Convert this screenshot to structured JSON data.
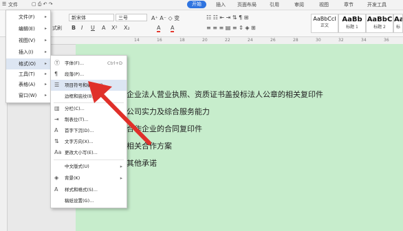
{
  "menubar": {
    "items": [
      "文件",
      "插入",
      "页面布局",
      "引用",
      "审阅",
      "视图",
      "章节",
      "开发工具"
    ],
    "active_tab": "开始"
  },
  "ribbon": {
    "font_name": "新宋体",
    "font_size": "三号",
    "paste_label": "式刷",
    "format_buttons": [
      "B",
      "I",
      "U",
      "A",
      "X²",
      "X₂",
      "A",
      "A"
    ],
    "styles": [
      {
        "preview": "AaBbCcI",
        "name": "正文"
      },
      {
        "preview": "AaBb",
        "name": "标题 1"
      },
      {
        "preview": "AaBbC",
        "name": "标题 2"
      },
      {
        "preview": "Aa",
        "name": "标"
      }
    ]
  },
  "ruler_ticks": [
    "14",
    "16",
    "18",
    "20",
    "22",
    "24",
    "26",
    "28",
    "30",
    "32",
    "34",
    "36"
  ],
  "main_menu": [
    {
      "label": "文件(F)",
      "arrow": "▸"
    },
    {
      "label": "编辑(E)",
      "arrow": "▸"
    },
    {
      "label": "视图(V)",
      "arrow": "▸"
    },
    {
      "label": "插入(I)",
      "arrow": "▸"
    },
    {
      "label": "格式(O)",
      "arrow": "▸"
    },
    {
      "label": "工具(T)",
      "arrow": "▸"
    },
    {
      "label": "表格(A)",
      "arrow": "▸"
    },
    {
      "label": "窗口(W)",
      "arrow": "▸"
    }
  ],
  "submenu": [
    {
      "icon": "Ⓣ",
      "label": "字体(F)...",
      "shortcut": "Ctrl+D"
    },
    {
      "icon": "¶",
      "label": "段落(P)...",
      "shortcut": ""
    },
    {
      "icon": "☰",
      "label": "项目符号和编号(N)...",
      "shortcut": ""
    },
    {
      "icon": "",
      "label": "边框和底纹(B)...",
      "shortcut": ""
    },
    {
      "icon": "▥",
      "label": "分栏(C)...",
      "shortcut": ""
    },
    {
      "icon": "⇥",
      "label": "制表位(T)...",
      "shortcut": ""
    },
    {
      "icon": "A",
      "label": "首字下沉(D)...",
      "shortcut": ""
    },
    {
      "icon": "⇅",
      "label": "文字方向(X)...",
      "shortcut": ""
    },
    {
      "icon": "Aa",
      "label": "更改大小写(E)...",
      "shortcut": ""
    },
    {
      "icon": "",
      "label": "中文版式(U)",
      "shortcut": "▸"
    },
    {
      "icon": "◈",
      "label": "背景(K)",
      "shortcut": "▸"
    },
    {
      "icon": "A",
      "label": "样式和格式(S)...",
      "shortcut": ""
    },
    {
      "icon": "",
      "label": "稿纸设置(G)...",
      "shortcut": ""
    }
  ],
  "document_lines": [
    "企业法人营业执照、资质证书盖投标法人公章的相关复印件",
    "公司实力及综合服务能力",
    "合作企业的合同复印件",
    "相关合作方案",
    "其他承诺"
  ],
  "colors": {
    "accent": "#2f74e0",
    "page_bg": "#c7edcc",
    "arrow": "#e0302a"
  }
}
